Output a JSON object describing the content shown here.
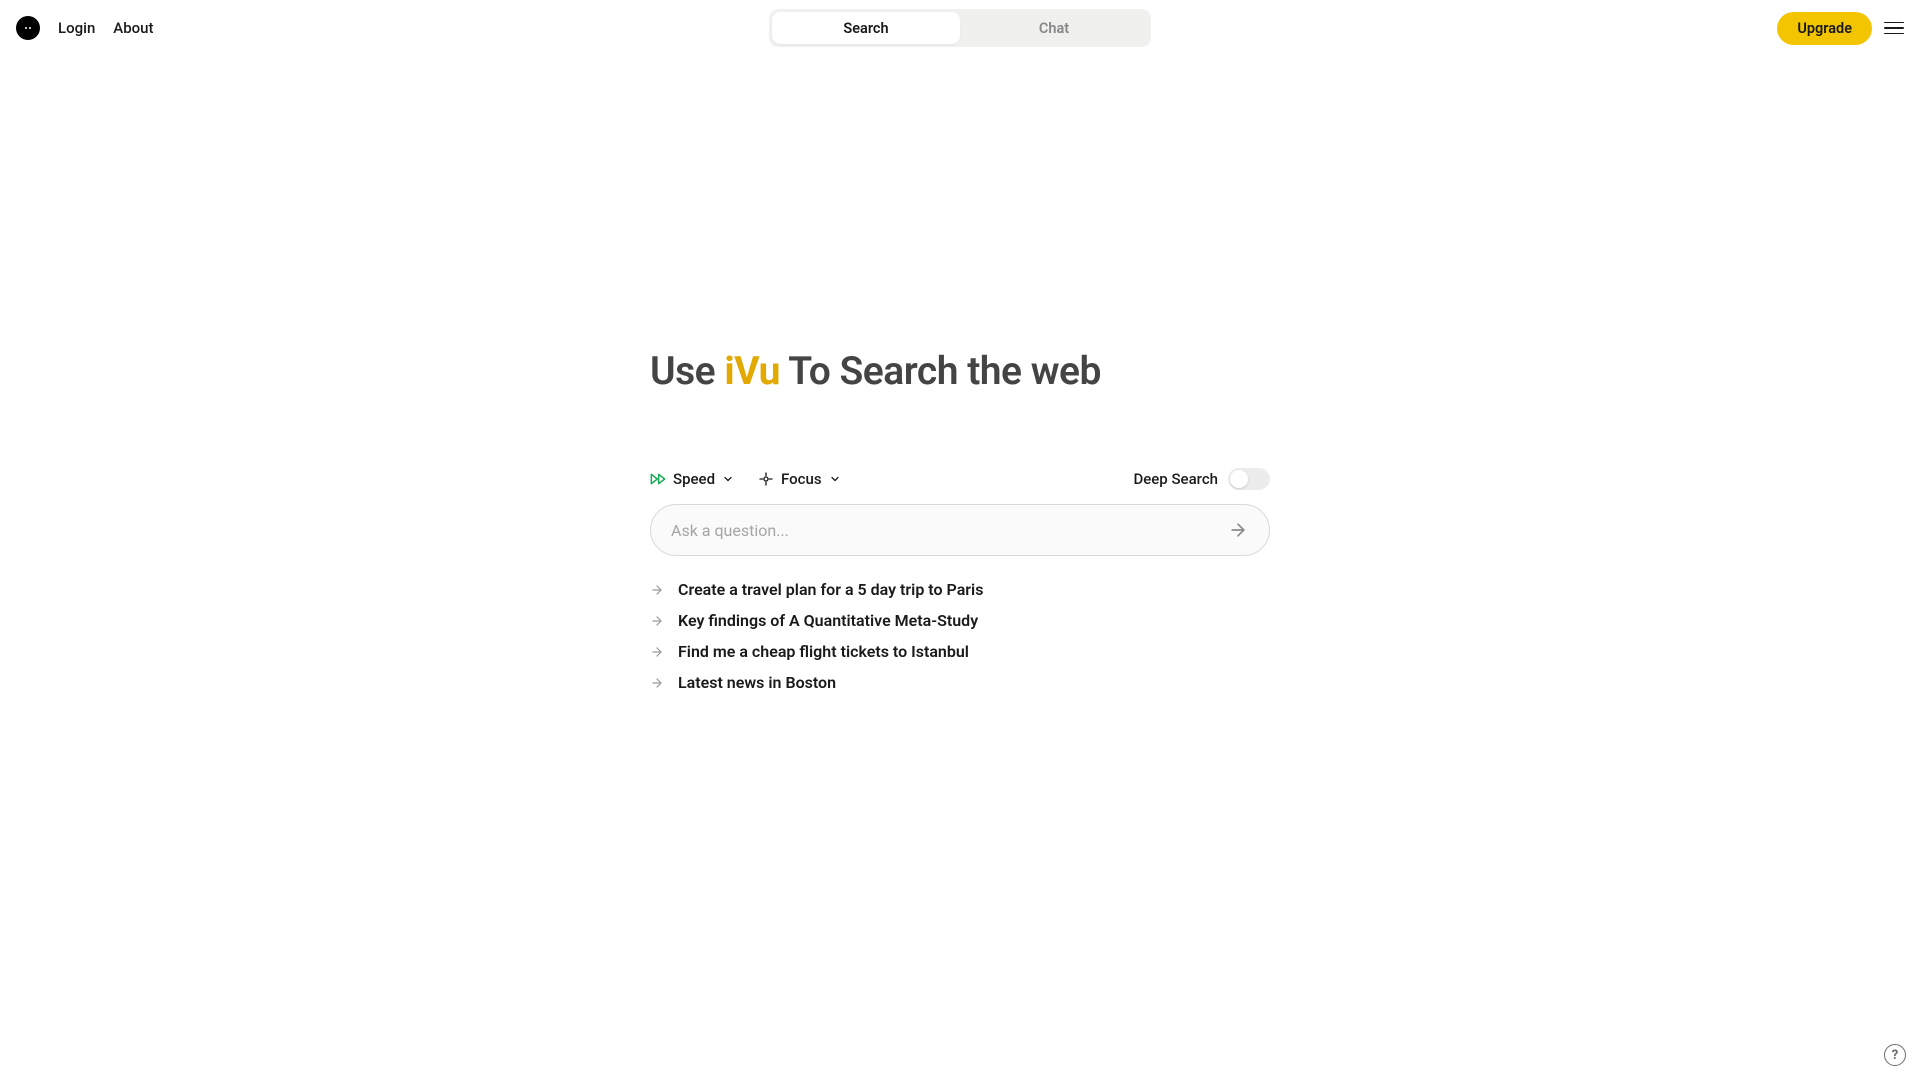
{
  "nav": {
    "login": "Login",
    "about": "About",
    "upgrade": "Upgrade"
  },
  "mode_tabs": {
    "search": "Search",
    "chat": "Chat",
    "active": "search"
  },
  "hero": {
    "prefix": "Use ",
    "brand": "iVu",
    "mid": " To  ",
    "suffix": "Search the web"
  },
  "controls": {
    "speed_label": "Speed",
    "focus_label": "Focus",
    "deep_search_label": "Deep Search",
    "deep_search_on": false
  },
  "search": {
    "placeholder": "Ask a question...",
    "value": ""
  },
  "suggestions": [
    "Create a travel plan for a 5 day trip to Paris",
    "Key findings of A Quantitative Meta-Study",
    "Find me a cheap flight tickets to Istanbul",
    "Latest news in Boston"
  ],
  "help": {
    "glyph": "?"
  }
}
